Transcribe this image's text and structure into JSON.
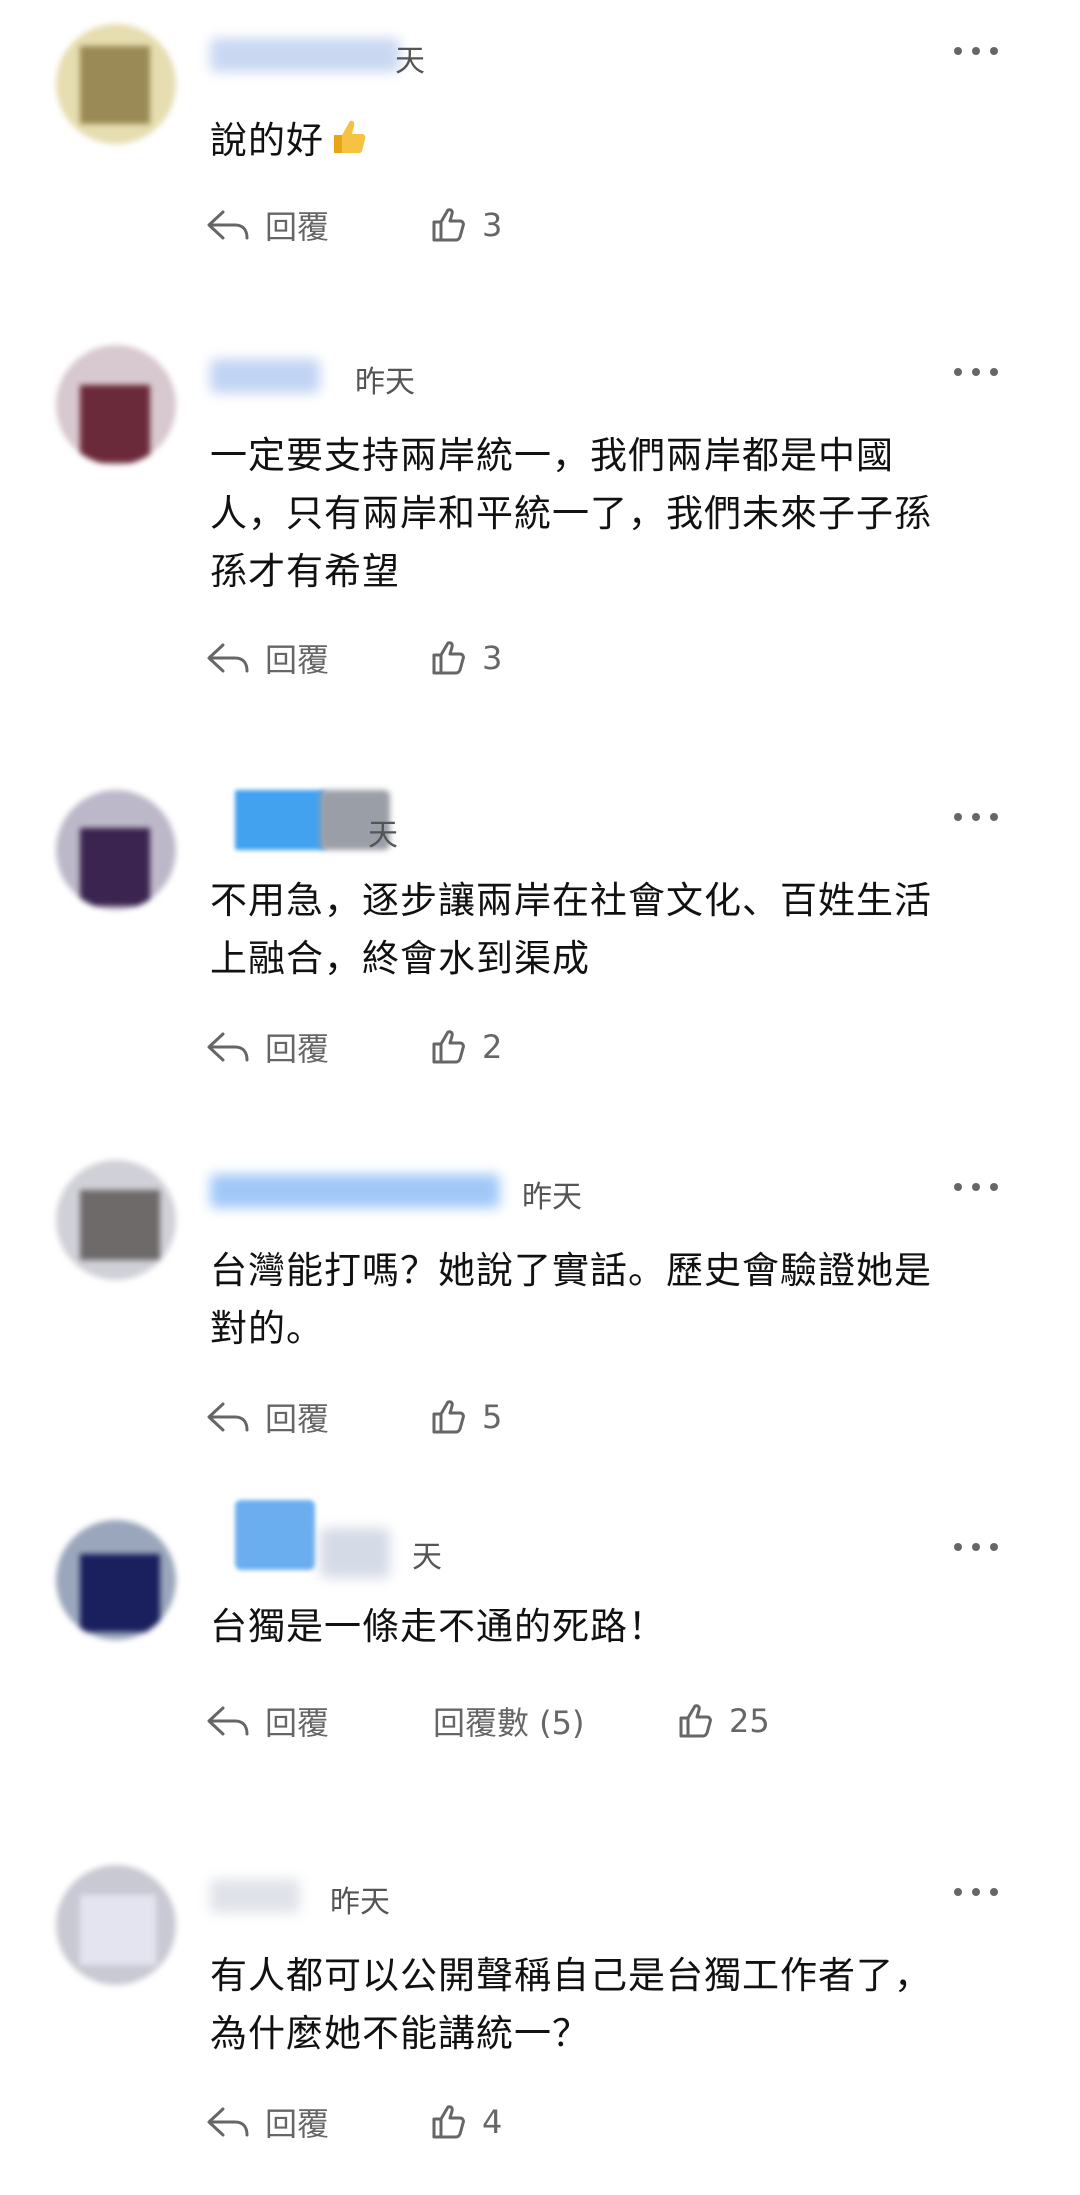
{
  "icons": {
    "reply": "reply-arrow-icon",
    "like": "thumbs-up-outline-icon",
    "more": "more-dots-icon",
    "emoji": "thumbs-up-emoji"
  },
  "colors": {
    "meta_text": "#555555",
    "action_text": "#666666",
    "body_text": "#111111"
  },
  "comments": [
    {
      "time": "天",
      "text": [
        "說的好"
      ],
      "has_emoji": true,
      "reply_label": "回覆",
      "likes": "3"
    },
    {
      "time": "昨天",
      "text": [
        "一定要支持兩岸統一，我們兩岸都是中國",
        "人，只有兩岸和平統一了，我們未來子子孫",
        "孫才有希望"
      ],
      "reply_label": "回覆",
      "likes": "3"
    },
    {
      "time": "天",
      "text": [
        "不用急，逐步讓兩岸在社會文化、百姓生活",
        "上融合，終會水到渠成"
      ],
      "reply_label": "回覆",
      "likes": "2"
    },
    {
      "time": "昨天",
      "text": [
        "台灣能打嗎？她說了實話。歷史會驗證她是",
        "對的。"
      ],
      "reply_label": "回覆",
      "likes": "5"
    },
    {
      "time": "天",
      "text": [
        "台獨是一條走不通的死路！"
      ],
      "reply_label": "回覆",
      "replies_label": "回覆數 (5)",
      "likes": "25"
    },
    {
      "time": "昨天",
      "text": [
        "有人都可以公開聲稱自己是台獨工作者了，",
        "為什麼她不能講統一？"
      ],
      "reply_label": "回覆",
      "likes": "4"
    }
  ]
}
